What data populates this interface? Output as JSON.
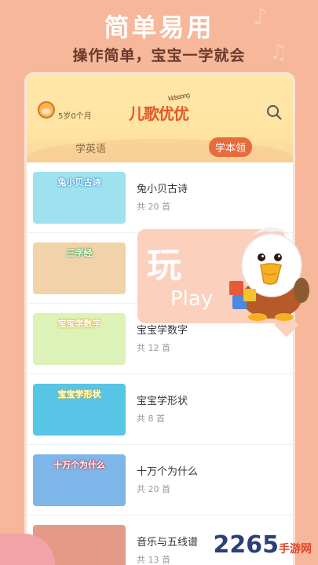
{
  "promo": {
    "title": "简单易用",
    "subtitle": "操作简单，宝宝一学就会"
  },
  "header": {
    "age": "5岁0个月",
    "logo_text": "儿歌优优",
    "logo_subtext": "kidssong",
    "search_icon": "search-icon",
    "tab_english": "学英语",
    "tab_skill": "学本领"
  },
  "list": {
    "items": [
      {
        "name": "兔小贝古诗",
        "count": "共 20 首",
        "thumb_title": "兔小贝古诗",
        "thumb_color": "#9FE1EE"
      },
      {
        "name": "",
        "count": "",
        "thumb_title": "三字经",
        "thumb_color": "#F2D3A9"
      },
      {
        "name": "宝宝学数字",
        "count": "共 12 首",
        "thumb_title": "宝宝学数字",
        "thumb_color": "#DDF2B7"
      },
      {
        "name": "宝宝学形状",
        "count": "共 8 首",
        "thumb_title": "宝宝学形状",
        "thumb_color": "#58C4E6"
      },
      {
        "name": "十万个为什么",
        "count": "共 20 首",
        "thumb_title": "十万个为什么",
        "thumb_color": "#7EB6EA"
      },
      {
        "name": "音乐与五线谱",
        "count": "共 13 首",
        "thumb_title": "",
        "thumb_color": "#E59A88"
      }
    ]
  },
  "play_card": {
    "character": "玩",
    "word": "Play"
  },
  "watermark": {
    "text": "2265",
    "suffix": "手游网"
  },
  "colors": {
    "background": "#F6B79A",
    "accent": "#E86B3C"
  }
}
